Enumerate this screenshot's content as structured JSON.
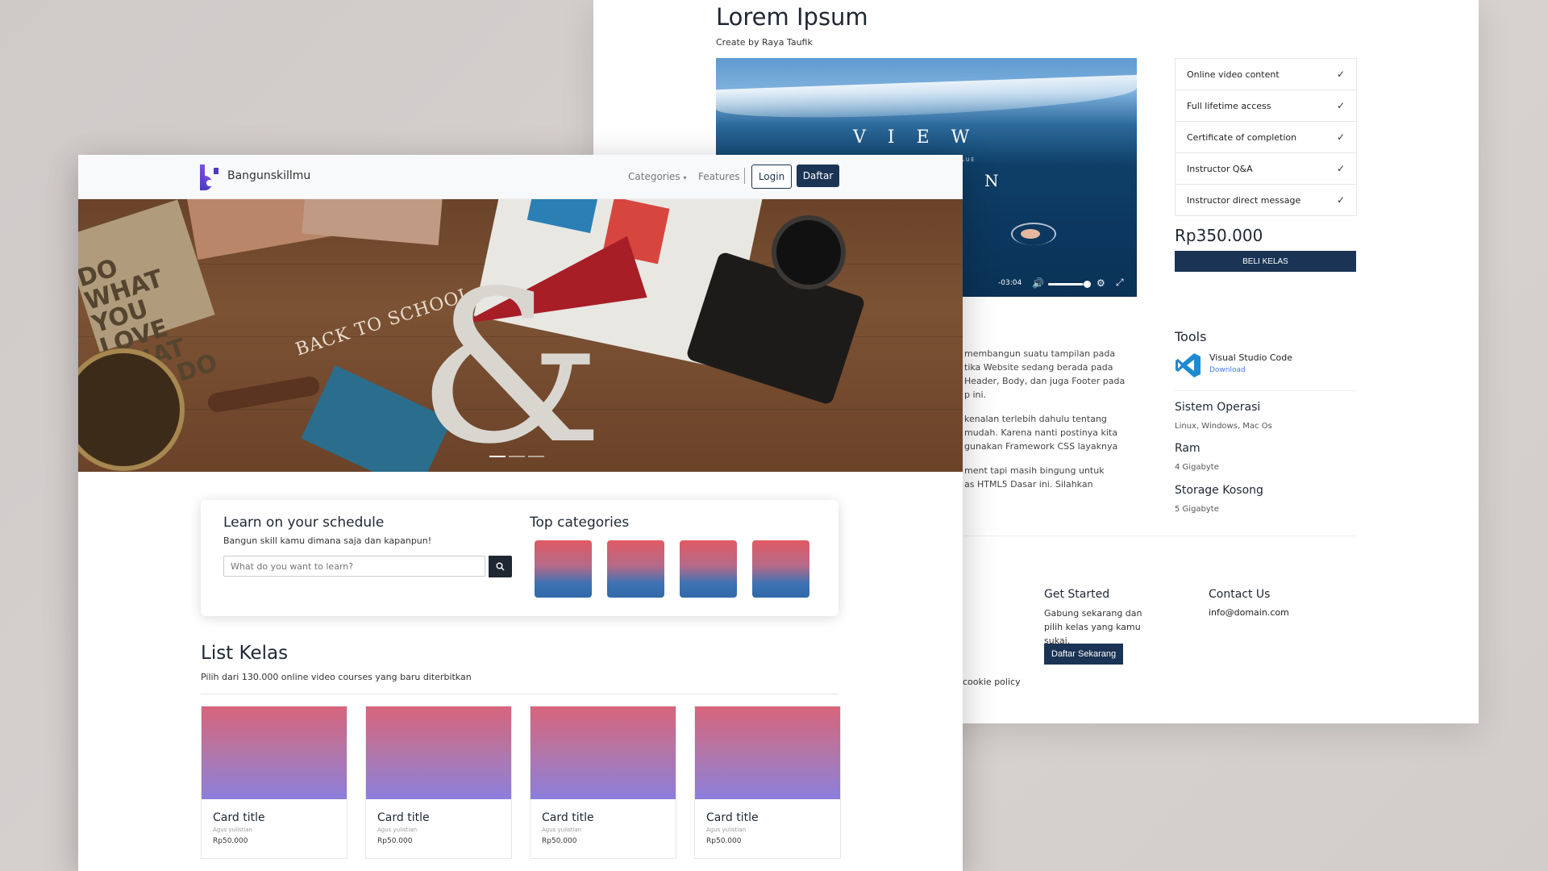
{
  "back": {
    "course_title": "Lorem Ipsum",
    "creator": "Create by Raya Taufik",
    "video": {
      "overlay_letters": "V I E W",
      "overlay_sub": "LUE",
      "overlay_n": "N",
      "time": "-03:04",
      "volume_level": 0.85
    },
    "features": [
      {
        "label": "Online video content"
      },
      {
        "label": "Full lifetime access"
      },
      {
        "label": "Certificate of completion"
      },
      {
        "label": "Instructor Q&A"
      },
      {
        "label": "Instructor direct message"
      }
    ],
    "price": "Rp350.000",
    "buy_label": "BELI KELAS",
    "description": [
      "membangun suatu tampilan pada",
      "tika Website sedang berada pada",
      "Header, Body, dan juga Footer pada",
      "p ini.",
      "kenalan terlebih dahulu tentang",
      "mudah. Karena nanti postinya kita",
      "gunakan Framework CSS layaknya",
      "ment tapi masih bingung untuk",
      "as HTML5 Dasar ini. Silahkan"
    ],
    "tools": {
      "heading": "Tools",
      "name": "Visual Studio Code",
      "link": "Download"
    },
    "specs": [
      {
        "label": "Sistem Operasi",
        "value": "Linux, Windows, Mac Os"
      },
      {
        "label": "Ram",
        "value": "4 Gigabyte"
      },
      {
        "label": "Storage Kosong",
        "value": "5 Gigabyte"
      }
    ],
    "footer": {
      "get_started_heading": "Get Started",
      "get_started_text": "Gabung sekarang dan pilih kelas yang kamu sukai.",
      "daftar_now": "Daftar Sekarang",
      "contact_heading": "Contact Us",
      "contact_email": "info@domain.com",
      "cookie": "cookie policy"
    }
  },
  "front": {
    "brand": "Bangunskillmu",
    "nav": {
      "categories": "Categories",
      "features": "Features",
      "login": "Login",
      "daftar": "Daftar"
    },
    "hero": {
      "notebook_text": "DO WHAT YOU LOVE WHAT YOU DO",
      "pennant_text": "BACK TO SCHOOL",
      "slides": 3,
      "active_slide": 1
    },
    "search": {
      "title": "Learn on your schedule",
      "subtitle": "Bangun skill kamu dimana saja dan kapanpun!",
      "placeholder": "What do you want to learn?",
      "categories_title": "Top categories",
      "category_count": 4
    },
    "list": {
      "title": "List Kelas",
      "subtitle": "Pilih dari 130.000 online video courses yang baru diterbitkan",
      "cards": [
        {
          "title": "Card title",
          "author": "Agus yulistian",
          "price": "Rp50.000"
        },
        {
          "title": "Card title",
          "author": "Agus yulistian",
          "price": "Rp50.000"
        },
        {
          "title": "Card title",
          "author": "Agus yulistian",
          "price": "Rp50.000"
        },
        {
          "title": "Card title",
          "author": "Agus yulistian",
          "price": "Rp50.000"
        }
      ]
    }
  },
  "colors": {
    "primary": "#1b3354",
    "background": "#d4cfcd",
    "card_gradient_top": "#d7647b",
    "card_gradient_bottom": "#8b7fdc"
  },
  "icons": {
    "search": "search-icon",
    "check": "check-icon",
    "volume": "volume-icon",
    "settings": "gear-icon",
    "fullscreen": "fullscreen-icon",
    "dropdown": "caret-down-icon"
  }
}
